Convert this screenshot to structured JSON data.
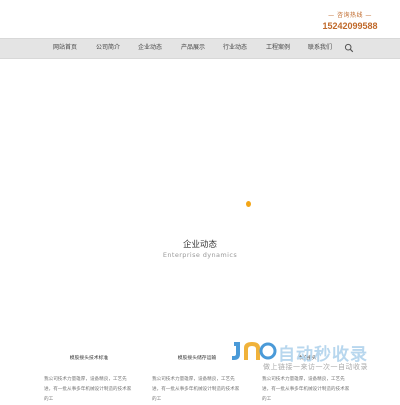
{
  "header": {
    "hotline_label": "— 咨询热线 —",
    "hotline_number": "15242099588"
  },
  "nav": {
    "items": [
      "网站首页",
      "公司简介",
      "企业动态",
      "产品展示",
      "行业动态",
      "工程案例",
      "联系我们"
    ]
  },
  "colors": {
    "accent": "#c0692a",
    "loader": "#f3a516",
    "nav_bg": "#e4e4e4"
  },
  "section": {
    "title_zh": "企业动态",
    "title_en": "Enterprise dynamics"
  },
  "cards": [
    {
      "title": "模胶接头技术标准",
      "lines": [
        "我公司技术力量雄厚，设备精良，工艺先",
        "进，有一批从事多年机械设计制造的技术家的工"
      ]
    },
    {
      "title": "模胶接头储存运输",
      "lines": [
        "我公司技术力量雄厚，设备精良，工艺先",
        "进，有一批从事多年机械设计制造的技术家的工"
      ]
    },
    {
      "title": "橡胶接头",
      "lines": [
        "我公司技术力量雄厚，设备精良，工艺先",
        "进，有一批从事多年机械设计制造的技术家的工"
      ]
    }
  ],
  "watermark": {
    "brand": "自动秒收录",
    "slogan": "做上链接一来访一次一自动收录"
  }
}
